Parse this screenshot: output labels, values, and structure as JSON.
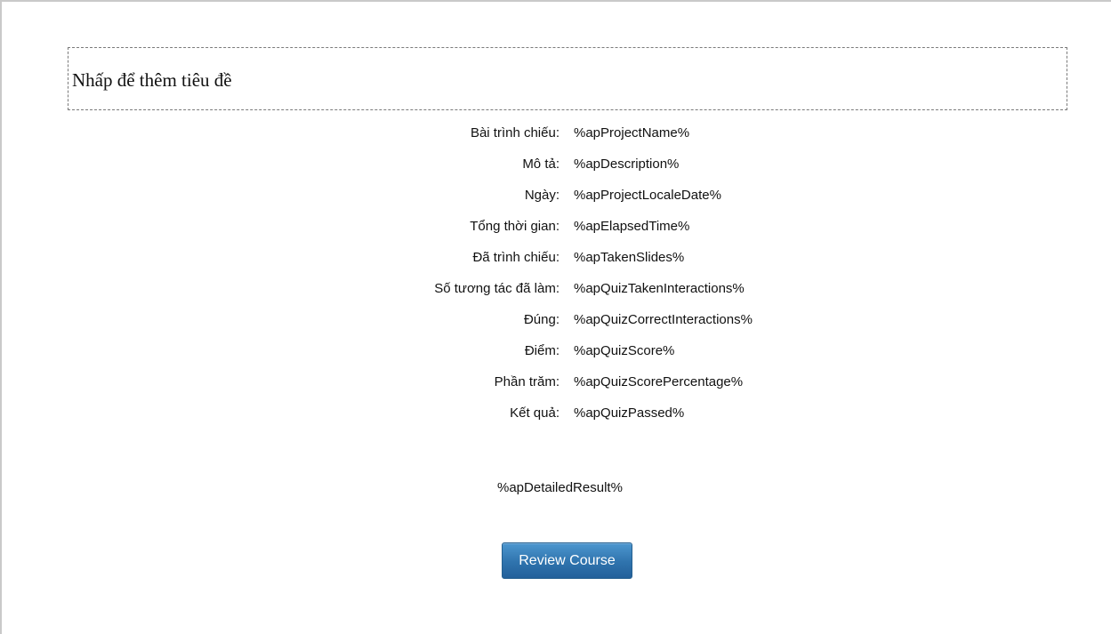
{
  "slide": {
    "title_placeholder": "Nhấp để thêm tiêu đề"
  },
  "results": {
    "rows": [
      {
        "label": "Bài trình chiếu:",
        "value": "%apProjectName%"
      },
      {
        "label": "Mô tả:",
        "value": "%apDescription%"
      },
      {
        "label": "Ngày:",
        "value": "%apProjectLocaleDate%"
      },
      {
        "label": "Tổng thời gian:",
        "value": "%apElapsedTime%"
      },
      {
        "label": "Đã trình chiếu:",
        "value": "%apTakenSlides%"
      },
      {
        "label": "Số tương tác đã làm:",
        "value": "%apQuizTakenInteractions%"
      },
      {
        "label": "Đúng:",
        "value": "%apQuizCorrectInteractions%"
      },
      {
        "label": "Điểm:",
        "value": "%apQuizScore%"
      },
      {
        "label": "Phần trăm:",
        "value": "%apQuizScorePercentage%"
      },
      {
        "label": "Kết quả:",
        "value": "%apQuizPassed%"
      }
    ],
    "detailed_result": "%apDetailedResult%"
  },
  "buttons": {
    "review_course": "Review Course"
  },
  "colors": {
    "button_blue": "#2f73ad",
    "button_text": "#ffffff",
    "placeholder_border": "#7a7a7a"
  }
}
